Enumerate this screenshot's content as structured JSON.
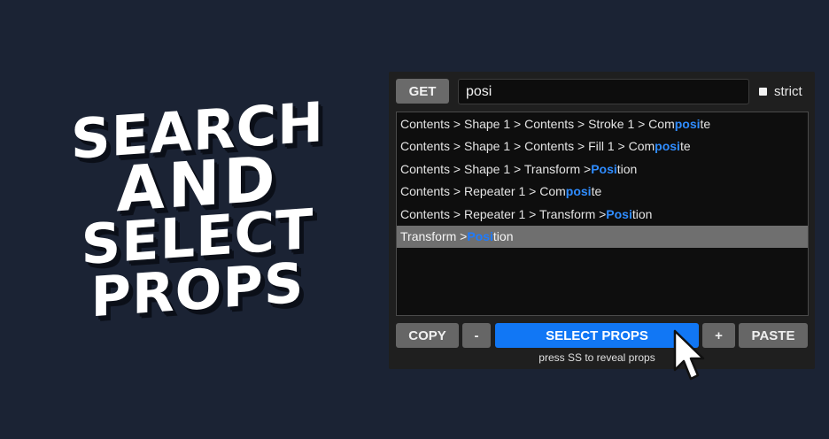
{
  "headline": {
    "line1": "SEARCH",
    "line2": "AND",
    "line3": "SELECT",
    "line4": "PROPS"
  },
  "panel": {
    "get_label": "GET",
    "search_value": "posi",
    "strict_label": "strict",
    "results": [
      {
        "pre": "Contents > Shape 1 > Contents > Stroke 1 > Com",
        "hl": "posi",
        "post": "te"
      },
      {
        "pre": "Contents > Shape 1 > Contents > Fill 1 > Com",
        "hl": "posi",
        "post": "te"
      },
      {
        "pre": "Contents > Shape 1 > Transform > ",
        "hl": "Posi",
        "post": "tion"
      },
      {
        "pre": "Contents > Repeater 1 > Com",
        "hl": "posi",
        "post": "te"
      },
      {
        "pre": "Contents > Repeater 1 > Transform > ",
        "hl": "Posi",
        "post": "tion"
      },
      {
        "pre": "Transform > ",
        "hl": "Posi",
        "post": "tion"
      }
    ],
    "copy_label": "COPY",
    "minus_label": "-",
    "select_label": "SELECT PROPS",
    "plus_label": "+",
    "paste_label": "PASTE",
    "hint": "press SS to reveal props"
  },
  "colors": {
    "background": "#1b2334",
    "accent": "#1177f5",
    "highlight": "#2f8cff"
  },
  "icons": {
    "cursor": "pointer-cursor-icon"
  }
}
